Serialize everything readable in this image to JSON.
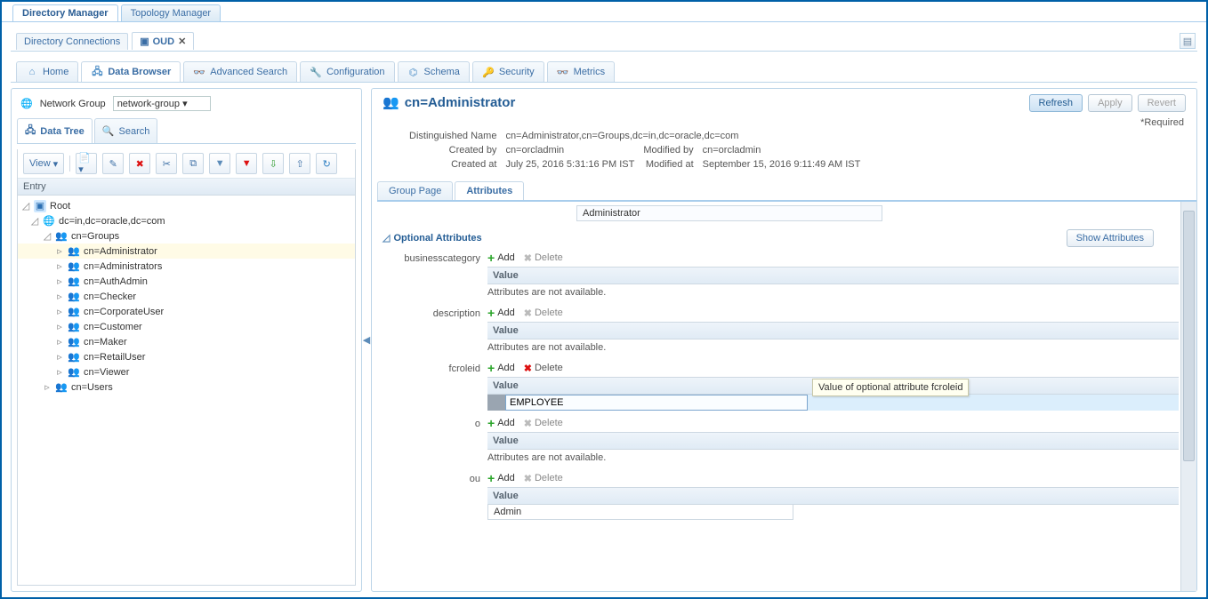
{
  "appTabs": [
    "Directory Manager",
    "Topology Manager"
  ],
  "appTabActive": 0,
  "connTabs": [
    {
      "label": "Directory Connections"
    },
    {
      "label": "OUD",
      "closable": true,
      "icon": "server"
    }
  ],
  "connTabActive": 1,
  "navTabs": [
    {
      "label": "Home",
      "icon": "home"
    },
    {
      "label": "Data Browser",
      "icon": "tree"
    },
    {
      "label": "Advanced Search",
      "icon": "binoculars"
    },
    {
      "label": "Configuration",
      "icon": "wrench"
    },
    {
      "label": "Schema",
      "icon": "schema"
    },
    {
      "label": "Security",
      "icon": "key"
    },
    {
      "label": "Metrics",
      "icon": "metrics"
    }
  ],
  "navTabActive": 1,
  "networkGroupLabel": "Network Group",
  "networkGroupValue": "network-group",
  "innerTabs": [
    "Data Tree",
    "Search"
  ],
  "innerTabActive": 0,
  "toolbar": {
    "view": "View"
  },
  "entryHeader": "Entry",
  "tree": {
    "root": "Root",
    "dc": "dc=in,dc=oracle,dc=com",
    "groups": "cn=Groups",
    "users": "cn=Users",
    "groupChildren": [
      "cn=Administrator",
      "cn=Administrators",
      "cn=AuthAdmin",
      "cn=Checker",
      "cn=CorporateUser",
      "cn=Customer",
      "cn=Maker",
      "cn=RetailUser",
      "cn=Viewer"
    ],
    "selected": "cn=Administrator"
  },
  "detail": {
    "titlePrefix": "cn=Administrator",
    "buttons": {
      "refresh": "Refresh",
      "apply": "Apply",
      "revert": "Revert"
    },
    "required": "*Required",
    "dnLabel": "Distinguished Name",
    "dn": "cn=Administrator,cn=Groups,dc=in,dc=oracle,dc=com",
    "createdByLbl": "Created by",
    "createdBy": "cn=orcladmin",
    "createdAtLbl": "Created at",
    "createdAt": "July 25, 2016 5:31:16 PM IST",
    "modifiedByLbl": "Modified by",
    "modifiedBy": "cn=orcladmin",
    "modifiedAtLbl": "Modified at",
    "modifiedAt": "September 15, 2016 9:11:49 AM IST"
  },
  "subTabs": [
    "Group Page",
    "Attributes"
  ],
  "subTabActive": 1,
  "adminBoxValue": "Administrator",
  "optionalHeading": "Optional Attributes",
  "showAttributes": "Show Attributes",
  "addLabel": "Add",
  "deleteLabel": "Delete",
  "valueHeader": "Value",
  "naText": "Attributes are not available.",
  "attributes": {
    "businesscategory": {
      "mode": "na"
    },
    "description": {
      "mode": "na"
    },
    "fcroleid": {
      "mode": "edit",
      "value": "EMPLOYEE",
      "tooltip": "Value of optional attribute fcroleid"
    },
    "o": {
      "mode": "na"
    },
    "ou": {
      "mode": "value",
      "value": "Admin"
    }
  }
}
